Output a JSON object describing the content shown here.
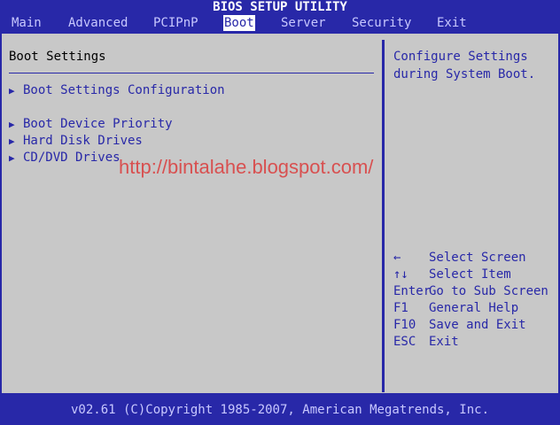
{
  "title": "BIOS SETUP UTILITY",
  "menu": {
    "items": [
      "Main",
      "Advanced",
      "PCIPnP",
      "Boot",
      "Server",
      "Security",
      "Exit"
    ],
    "active": "Boot"
  },
  "left_pane": {
    "section_title": "Boot Settings",
    "entries": [
      "Boot Settings Configuration",
      "Boot Device Priority",
      "Hard Disk Drives",
      "CD/DVD Drives"
    ]
  },
  "right_pane": {
    "help": "Configure Settings\nduring System Boot.",
    "keys": [
      {
        "key": "←",
        "action": "Select Screen"
      },
      {
        "key": "↑↓",
        "action": "Select Item"
      },
      {
        "key": "Enter",
        "action": "Go to Sub Screen"
      },
      {
        "key": "F1",
        "action": "General Help"
      },
      {
        "key": "F10",
        "action": "Save and Exit"
      },
      {
        "key": "ESC",
        "action": "Exit"
      }
    ]
  },
  "watermark": "http://bintalahe.blogspot.com/",
  "status_bar": "v02.61 (C)Copyright 1985-2007, American Megatrends, Inc.",
  "colors": {
    "background": "#2828a8",
    "panel": "#c8c8c8",
    "text_blue": "#2828a8",
    "watermark": "#d85050"
  }
}
